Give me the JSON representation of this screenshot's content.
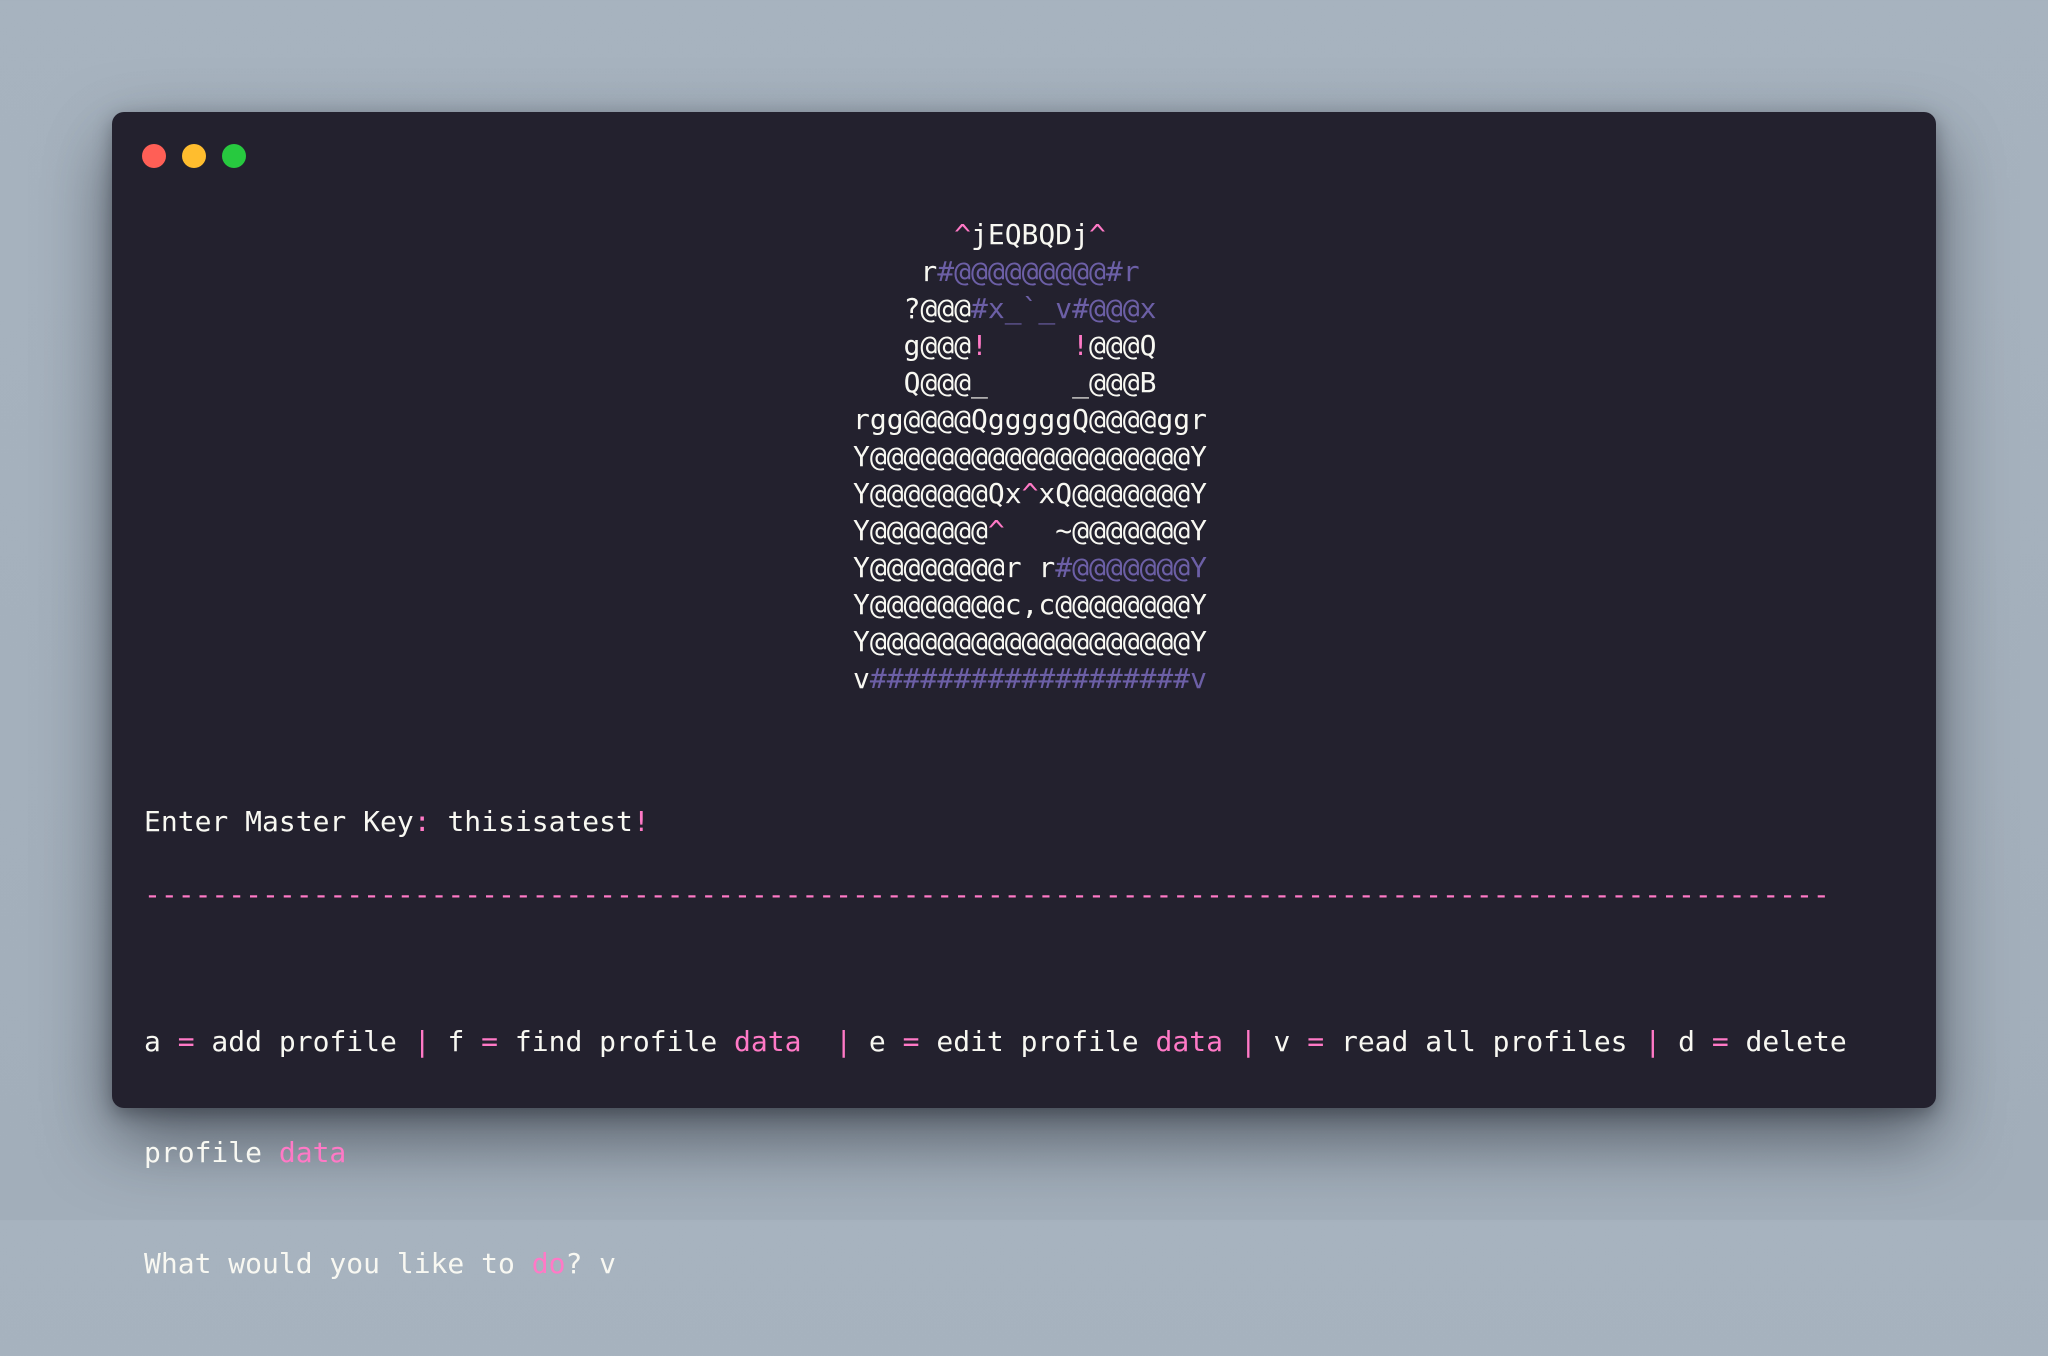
{
  "window": {
    "controls": [
      "close",
      "minimize",
      "zoom"
    ],
    "colors": {
      "close": "#ff5f56",
      "minimize": "#ffbd2e",
      "zoom": "#27c93f"
    }
  },
  "art": {
    "lines": [
      [
        [
          "p",
          "^"
        ],
        [
          "w",
          "jEQBQDj"
        ],
        [
          "p",
          "^"
        ]
      ],
      [
        [
          "w",
          "r"
        ],
        [
          "u",
          "#@@@@@@@@@#r"
        ]
      ],
      [
        [
          "w",
          "?@@@"
        ],
        [
          "u",
          "#x_`_v#@@@x"
        ]
      ],
      [
        [
          "w",
          "g@@@"
        ],
        [
          "p",
          "!"
        ],
        [
          "w",
          "     "
        ],
        [
          "p",
          "!"
        ],
        [
          "w",
          "@@@Q"
        ]
      ],
      [
        [
          "w",
          "Q@@@_     _@@@B"
        ]
      ],
      [
        [
          "w",
          "rgg@@@@QgggggQ@@@@ggr"
        ]
      ],
      [
        [
          "w",
          "Y@@@@@@@@@@@@@@@@@@@Y"
        ]
      ],
      [
        [
          "w",
          "Y@@@@@@@Qx"
        ],
        [
          "p",
          "^"
        ],
        [
          "w",
          "xQ@@@@@@@Y"
        ]
      ],
      [
        [
          "w",
          "Y@@@@@@@"
        ],
        [
          "p",
          "^"
        ],
        [
          "w",
          "   ~@@@@@@@Y"
        ]
      ],
      [
        [
          "w",
          "Y@@@@@@@@r r"
        ],
        [
          "u",
          "#@@@@@@@Y"
        ]
      ],
      [
        [
          "w",
          "Y@@@@@@@@c,c@@@@@@@@Y"
        ]
      ],
      [
        [
          "w",
          "Y@@@@@@@@@@@@@@@@@@@Y"
        ]
      ],
      [
        [
          "w",
          "v"
        ],
        [
          "u",
          "###################v"
        ]
      ]
    ]
  },
  "prompt": {
    "label": "Enter Master Key",
    "colon": ":",
    "value": "thisisatest",
    "bang": "!"
  },
  "divider": {
    "text": "----------------------------------------------------------------------------------------------------"
  },
  "menu": {
    "line1": [
      [
        "w",
        "a "
      ],
      [
        "p",
        "="
      ],
      [
        "w",
        " add profile "
      ],
      [
        "p",
        "|"
      ],
      [
        "w",
        " f "
      ],
      [
        "p",
        "="
      ],
      [
        "w",
        " find profile "
      ],
      [
        "p",
        "data"
      ],
      [
        "w",
        "  "
      ],
      [
        "p",
        "|"
      ],
      [
        "w",
        " e "
      ],
      [
        "p",
        "="
      ],
      [
        "w",
        " edit profile "
      ],
      [
        "p",
        "data"
      ],
      [
        "w",
        " "
      ],
      [
        "p",
        "|"
      ],
      [
        "w",
        " v "
      ],
      [
        "p",
        "="
      ],
      [
        "w",
        " read all profiles "
      ],
      [
        "p",
        "|"
      ],
      [
        "w",
        " d "
      ],
      [
        "p",
        "="
      ],
      [
        "w",
        " delete"
      ]
    ],
    "line2": [
      [
        "w",
        "profile "
      ],
      [
        "p",
        "data"
      ]
    ],
    "question": [
      [
        "w",
        "What would you like to "
      ],
      [
        "p",
        "do"
      ],
      [
        "w",
        "? v"
      ]
    ]
  }
}
